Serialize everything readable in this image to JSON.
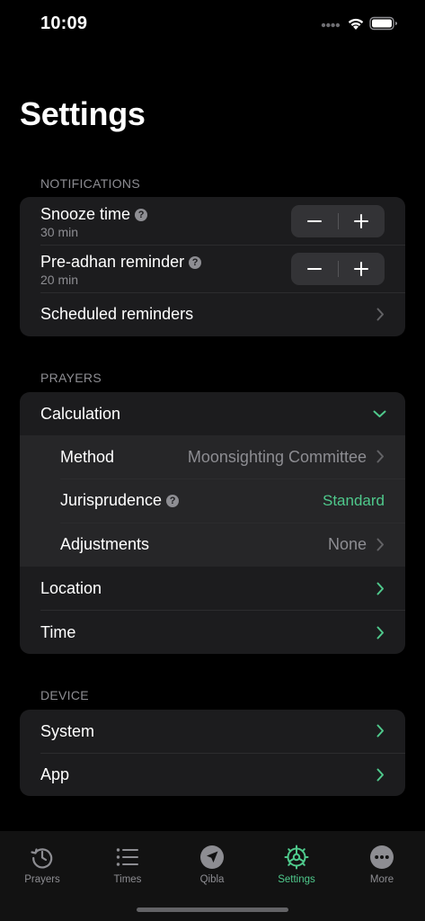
{
  "status": {
    "time": "10:09"
  },
  "title": "Settings",
  "colors": {
    "accent": "#4fc98c",
    "background": "#000000",
    "card": "#1c1c1e",
    "secondary_text": "#8d8d92"
  },
  "notifications": {
    "header": "NOTIFICATIONS",
    "snooze": {
      "label": "Snooze time",
      "value": "30 min"
    },
    "pre_adhan": {
      "label": "Pre-adhan reminder",
      "value": "20 min"
    },
    "scheduled": {
      "label": "Scheduled reminders"
    }
  },
  "prayers": {
    "header": "PRAYERS",
    "calculation": {
      "label": "Calculation"
    },
    "method": {
      "label": "Method",
      "value": "Moonsighting Committee"
    },
    "jurisprudence": {
      "label": "Jurisprudence",
      "value": "Standard"
    },
    "adjustments": {
      "label": "Adjustments",
      "value": "None"
    },
    "location": {
      "label": "Location"
    },
    "time": {
      "label": "Time"
    }
  },
  "device": {
    "header": "DEVICE",
    "system": {
      "label": "System"
    },
    "app": {
      "label": "App"
    }
  },
  "tabs": [
    {
      "label": "Prayers",
      "icon": "history-clock-icon"
    },
    {
      "label": "Times",
      "icon": "list-icon"
    },
    {
      "label": "Qibla",
      "icon": "compass-arrow-icon"
    },
    {
      "label": "Settings",
      "icon": "gear-icon",
      "active": true
    },
    {
      "label": "More",
      "icon": "ellipsis-circle-icon"
    }
  ]
}
